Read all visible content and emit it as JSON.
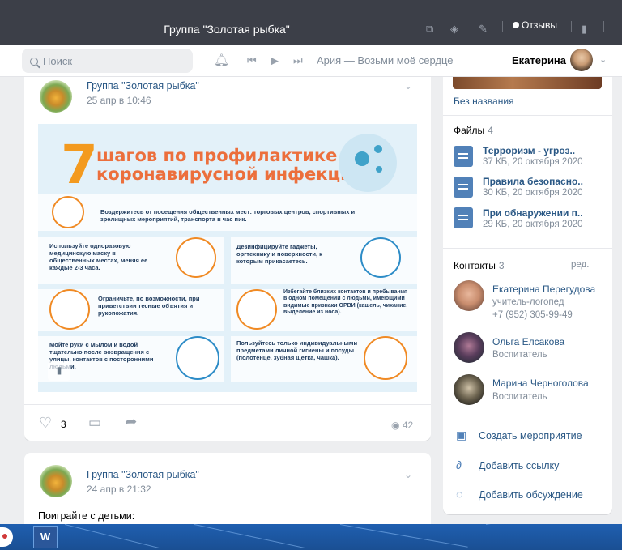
{
  "window": {
    "title": "Группа \"Золотая рыбка\"",
    "reviews_label": "Отзывы"
  },
  "header": {
    "search_placeholder": "Поиск",
    "now_playing": "Ария — Возьми моё сердце",
    "user_name": "Екатерина"
  },
  "posts": [
    {
      "author": "Группа \"Золотая рыбка\"",
      "date": "25 апр в 10:46",
      "image": {
        "number": "7",
        "heading_line1": "шагов по профилактике",
        "heading_line2": "коронавирусной инфекции",
        "tips": [
          "Воздержитесь от посещения общественных мест: торговых центров, спортивных и зрелищных мероприятий, транспорта в час пик.",
          "Используйте одноразовую медицинскую маску в общественных местах, меняя ее каждые 2-3 часа.",
          "Дезинфицируйте гаджеты, оргтехнику и поверхности, к которым прикасаетесь.",
          "Ограничьте, по возможности, при приветствии тесные объятия и рукопожатия.",
          "Избегайте близких контактов и пребывания в одном помещении с людьми, имеющими видимые признаки ОРВИ (кашель, чихание, выделение из носа).",
          "Мойте руки с мылом и водой тщательно после возвращения с улицы, контактов с посторонними людьми.",
          "Пользуйтесь только индивидуальными предметами личной гигиены и посуды (полотенце, зубная щетка, чашка)."
        ]
      },
      "likes": "3",
      "views": "42"
    },
    {
      "author": "Группа \"Золотая рыбка\"",
      "date": "24 апр в 21:32",
      "text": "Поиграйте с детьми:"
    }
  ],
  "sidebar": {
    "album_caption": "Без названия",
    "files": {
      "title": "Файлы",
      "count": "4",
      "items": [
        {
          "name": "Терроризм - угроз..",
          "meta": "37 КБ, 20 октября 2020"
        },
        {
          "name": "Правила безопасно..",
          "meta": "30 КБ, 20 октября 2020"
        },
        {
          "name": "При обнаружении п..",
          "meta": "29 КБ, 20 октября 2020"
        }
      ]
    },
    "contacts": {
      "title": "Контакты",
      "count": "3",
      "edit_label": "ред.",
      "items": [
        {
          "name": "Екатерина Перегудова",
          "role": "учитель-логопед",
          "phone": "+7 (952) 305-99-49"
        },
        {
          "name": "Ольга Елсакова",
          "role": "Воспитатель"
        },
        {
          "name": "Марина Черноголова",
          "role": "Воспитатель"
        }
      ]
    },
    "actions": [
      {
        "label": "Создать мероприятие",
        "icon": "calendar-icon"
      },
      {
        "label": "Добавить ссылку",
        "icon": "link-icon"
      },
      {
        "label": "Добавить обсуждение",
        "icon": "discussion-icon"
      }
    ]
  },
  "taskbar": {
    "word_label": "W"
  },
  "colors": {
    "titlebar": "#3c3f48",
    "link": "#2a5885",
    "accent": "#5181b8",
    "page_bg": "#edeef0",
    "taskbar": "#1f5fb0",
    "infographic_orange": "#f39a1f"
  }
}
